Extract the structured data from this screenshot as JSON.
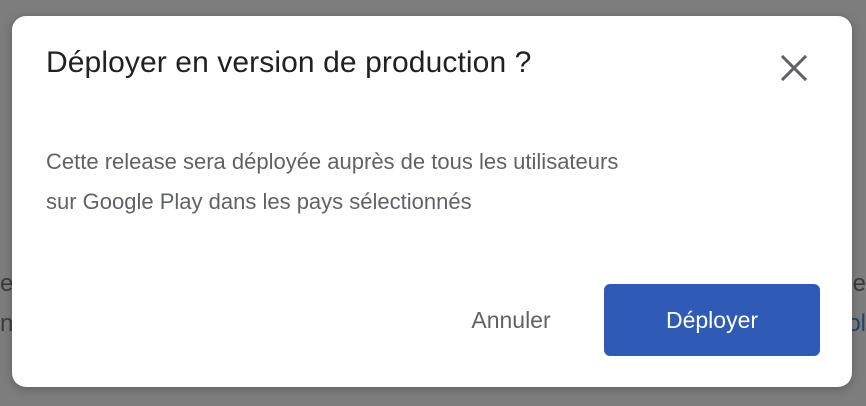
{
  "background": {
    "left_fragments": [
      "e",
      "na"
    ],
    "right_fragments": [
      "re",
      "ol"
    ]
  },
  "dialog": {
    "title": "Déployer en version de production ?",
    "close_icon": "close-icon",
    "body_line_1": "Cette release sera déployée auprès de tous les utilisateurs",
    "body_line_2": "sur Google Play dans les pays sélectionnés",
    "cancel_label": "Annuler",
    "confirm_label": "Déployer"
  },
  "colors": {
    "primary_button": "#2f5bb7",
    "title_text": "#202124",
    "body_text": "#5f6368",
    "overlay": "#7d7d7d"
  }
}
